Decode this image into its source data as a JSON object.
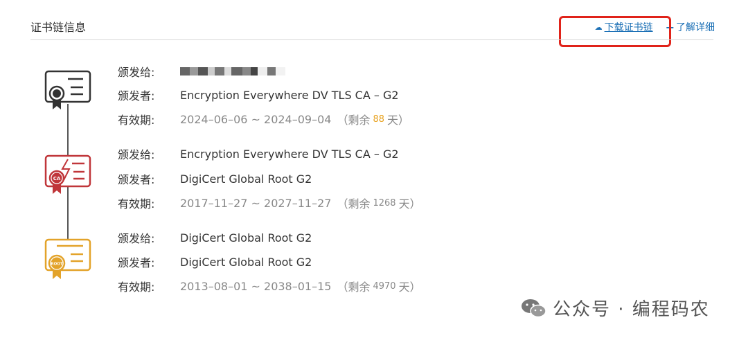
{
  "header": {
    "title": "证书链信息",
    "download_label": "下载证书链",
    "more_label": "了解详细"
  },
  "labels": {
    "issued_to": "颁发给:",
    "issuer": "颁发者:",
    "validity": "有效期:"
  },
  "certs": [
    {
      "type": "leaf",
      "issued_to": "",
      "issuer": "Encryption Everywhere DV TLS CA – G2",
      "valid_range": "2024–06–06 ~ 2024–09–04",
      "remaining_prefix": "（剩余",
      "remaining_days": "88",
      "remaining_suffix": "天）",
      "color": "#333333"
    },
    {
      "type": "intermediate",
      "issued_to": "Encryption Everywhere DV TLS CA – G2",
      "issuer": "DigiCert Global Root G2",
      "valid_range": "2017–11–27 ~ 2027–11–27",
      "remaining_prefix": "（剩余",
      "remaining_days": "1268",
      "remaining_suffix": "天）",
      "badge": "CA",
      "color": "#c0363a"
    },
    {
      "type": "root",
      "issued_to": "DigiCert Global Root G2",
      "issuer": "DigiCert Global Root G2",
      "valid_range": "2013–08–01 ~ 2038–01–15",
      "remaining_prefix": "（剩余",
      "remaining_days": "4970",
      "remaining_suffix": "天）",
      "badge": "ROOT",
      "color": "#e3a32a"
    }
  ],
  "watermark": {
    "text": "公众号 · 编程码农"
  },
  "colors": {
    "link": "#1a6fb5",
    "highlight": "#e0231a",
    "days_accent": "#e8a21f"
  }
}
